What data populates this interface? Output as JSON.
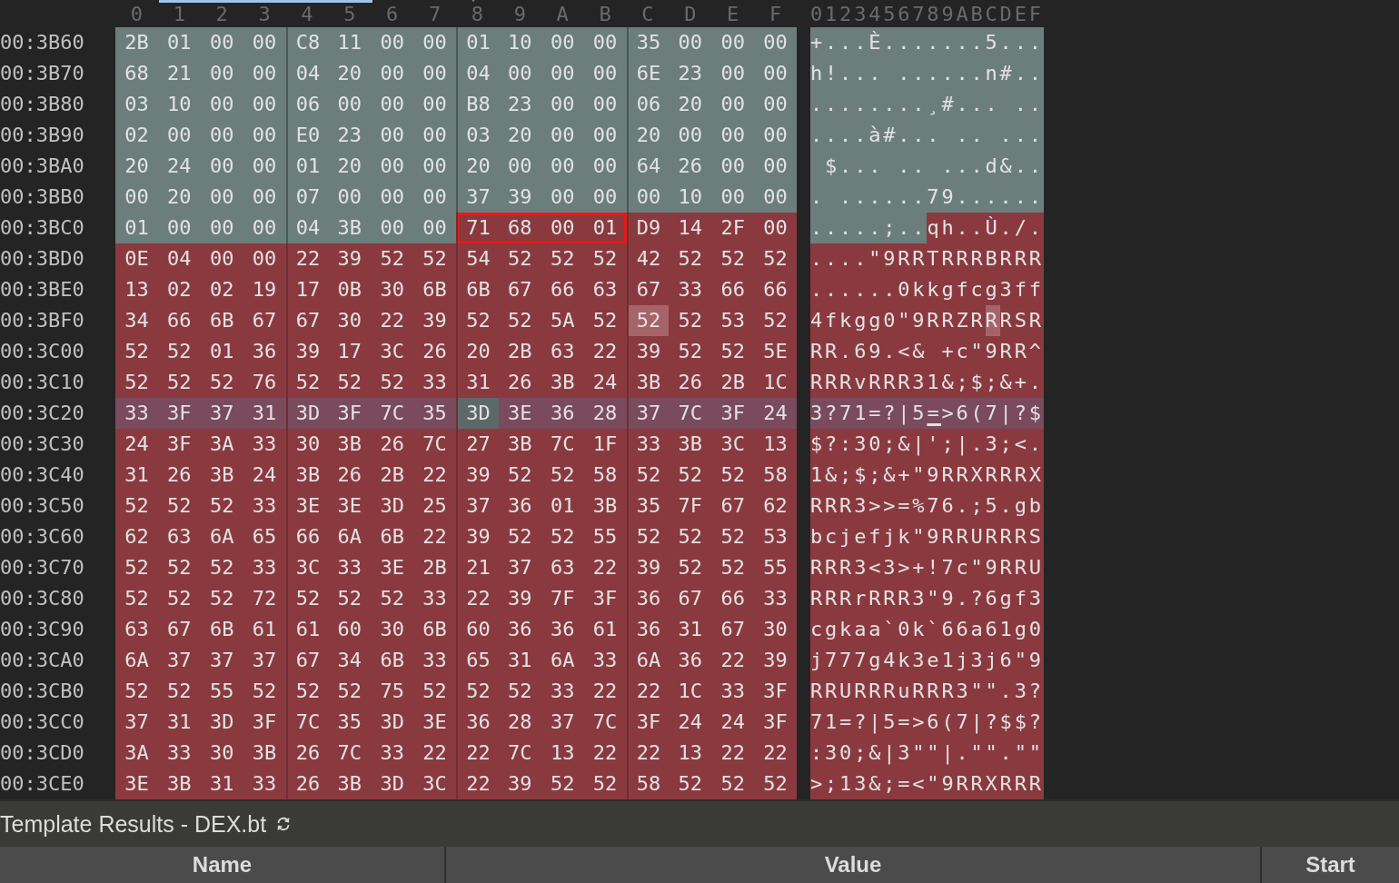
{
  "columns": [
    "0",
    "1",
    "2",
    "3",
    "4",
    "5",
    "6",
    "7",
    "8",
    "9",
    "A",
    "B",
    "C",
    "D",
    "E",
    "F"
  ],
  "ascii_header": "0123456789ABCDEF",
  "rows": [
    {
      "address": "00:3B60",
      "selected": false,
      "segments": [
        {
          "kind": "header",
          "bytes": [
            "2B",
            "01",
            "00",
            "00",
            "C8",
            "11",
            "00",
            "00",
            "01",
            "10",
            "00",
            "00",
            "35",
            "00",
            "00",
            "00"
          ],
          "ascii": "+...È.......5..."
        }
      ]
    },
    {
      "address": "00:3B70",
      "selected": false,
      "segments": [
        {
          "kind": "header",
          "bytes": [
            "68",
            "21",
            "00",
            "00",
            "04",
            "20",
            "00",
            "00",
            "04",
            "00",
            "00",
            "00",
            "6E",
            "23",
            "00",
            "00"
          ],
          "ascii": "h!... ......n#.."
        }
      ]
    },
    {
      "address": "00:3B80",
      "selected": false,
      "segments": [
        {
          "kind": "header",
          "bytes": [
            "03",
            "10",
            "00",
            "00",
            "06",
            "00",
            "00",
            "00",
            "B8",
            "23",
            "00",
            "00",
            "06",
            "20",
            "00",
            "00"
          ],
          "ascii": "........¸#... .."
        }
      ]
    },
    {
      "address": "00:3B90",
      "selected": false,
      "segments": [
        {
          "kind": "header",
          "bytes": [
            "02",
            "00",
            "00",
            "00",
            "E0",
            "23",
            "00",
            "00",
            "03",
            "20",
            "00",
            "00",
            "20",
            "00",
            "00",
            "00"
          ],
          "ascii": "....à#... .. ..."
        }
      ]
    },
    {
      "address": "00:3BA0",
      "selected": false,
      "segments": [
        {
          "kind": "header",
          "bytes": [
            "20",
            "24",
            "00",
            "00",
            "01",
            "20",
            "00",
            "00",
            "20",
            "00",
            "00",
            "00",
            "64",
            "26",
            "00",
            "00"
          ],
          "ascii": " $... .. ...d&.."
        }
      ]
    },
    {
      "address": "00:3BB0",
      "selected": false,
      "segments": [
        {
          "kind": "header",
          "bytes": [
            "00",
            "20",
            "00",
            "00",
            "07",
            "00",
            "00",
            "00",
            "37",
            "39",
            "00",
            "00",
            "00",
            "10",
            "00",
            "00"
          ],
          "ascii": ". ......79......"
        }
      ]
    },
    {
      "address": "00:3BC0",
      "selected": false,
      "segments": [
        {
          "kind": "header",
          "bytes": [
            "01",
            "00",
            "00",
            "00",
            "04",
            "3B",
            "00",
            "00"
          ],
          "ascii": ".....;.."
        },
        {
          "kind": "marked",
          "bytes": [
            "71",
            "68",
            "00",
            "01"
          ],
          "ascii": "qh.."
        },
        {
          "kind": "data",
          "bytes": [
            "D9",
            "14",
            "2F",
            "00"
          ],
          "ascii": "Ù./."
        }
      ]
    },
    {
      "address": "00:3BD0",
      "selected": false,
      "segments": [
        {
          "kind": "data",
          "bytes": [
            "0E",
            "04",
            "00",
            "00",
            "22",
            "39",
            "52",
            "52",
            "54",
            "52",
            "52",
            "52",
            "42",
            "52",
            "52",
            "52"
          ],
          "ascii": "....\"9RRTRRRBRRR"
        }
      ]
    },
    {
      "address": "00:3BE0",
      "selected": false,
      "segments": [
        {
          "kind": "data",
          "bytes": [
            "13",
            "02",
            "02",
            "19",
            "17",
            "0B",
            "30",
            "6B",
            "6B",
            "67",
            "66",
            "63",
            "67",
            "33",
            "66",
            "66"
          ],
          "ascii": "......0kkgfcg3ff"
        }
      ]
    },
    {
      "address": "00:3BF0",
      "selected": false,
      "segments": [
        {
          "kind": "data",
          "bytes": [
            "34",
            "66",
            "6B",
            "67",
            "67",
            "30",
            "22",
            "39",
            "52",
            "52",
            "5A",
            "52"
          ],
          "ascii": "4fkgg0\"9RRZR"
        },
        {
          "kind": "match",
          "bytes": [
            "52"
          ],
          "ascii": "R"
        },
        {
          "kind": "data",
          "bytes": [
            "52",
            "53",
            "52"
          ],
          "ascii": "RSR"
        }
      ]
    },
    {
      "address": "00:3C00",
      "selected": false,
      "segments": [
        {
          "kind": "data",
          "bytes": [
            "52",
            "52",
            "01",
            "36",
            "39",
            "17",
            "3C",
            "26",
            "20",
            "2B",
            "63",
            "22",
            "39",
            "52",
            "52",
            "5E"
          ],
          "ascii": "RR.69.<& +c\"9RR^"
        }
      ]
    },
    {
      "address": "00:3C10",
      "selected": false,
      "segments": [
        {
          "kind": "data",
          "bytes": [
            "52",
            "52",
            "52",
            "76",
            "52",
            "52",
            "52",
            "33",
            "31",
            "26",
            "3B",
            "24",
            "3B",
            "26",
            "2B",
            "1C"
          ],
          "ascii": "RRRvRRR31&;$;&+."
        }
      ]
    },
    {
      "address": "00:3C20",
      "selected": true,
      "segments": [
        {
          "kind": "data",
          "bytes": [
            "33",
            "3F",
            "37",
            "31",
            "3D",
            "3F",
            "7C",
            "35"
          ],
          "ascii": "3?71=?|5"
        },
        {
          "kind": "cursor",
          "bytes": [
            "3D"
          ],
          "ascii": "="
        },
        {
          "kind": "data",
          "bytes": [
            "3E",
            "36",
            "28",
            "37",
            "7C",
            "3F",
            "24"
          ],
          "ascii": ">6(7|?$"
        }
      ]
    },
    {
      "address": "00:3C30",
      "selected": false,
      "segments": [
        {
          "kind": "data",
          "bytes": [
            "24",
            "3F",
            "3A",
            "33",
            "30",
            "3B",
            "26",
            "7C",
            "27",
            "3B",
            "7C",
            "1F",
            "33",
            "3B",
            "3C",
            "13"
          ],
          "ascii": "$?:30;&|';|.3;<."
        }
      ]
    },
    {
      "address": "00:3C40",
      "selected": false,
      "segments": [
        {
          "kind": "data",
          "bytes": [
            "31",
            "26",
            "3B",
            "24",
            "3B",
            "26",
            "2B",
            "22",
            "39",
            "52",
            "52",
            "58",
            "52",
            "52",
            "52",
            "58"
          ],
          "ascii": "1&;$;&+\"9RRXRRRX"
        }
      ]
    },
    {
      "address": "00:3C50",
      "selected": false,
      "segments": [
        {
          "kind": "data",
          "bytes": [
            "52",
            "52",
            "52",
            "33",
            "3E",
            "3E",
            "3D",
            "25",
            "37",
            "36",
            "01",
            "3B",
            "35",
            "7F",
            "67",
            "62"
          ],
          "ascii": "RRR3>>=%76.;5.gb"
        }
      ]
    },
    {
      "address": "00:3C60",
      "selected": false,
      "segments": [
        {
          "kind": "data",
          "bytes": [
            "62",
            "63",
            "6A",
            "65",
            "66",
            "6A",
            "6B",
            "22",
            "39",
            "52",
            "52",
            "55",
            "52",
            "52",
            "52",
            "53"
          ],
          "ascii": "bcjefjk\"9RRURRRS"
        }
      ]
    },
    {
      "address": "00:3C70",
      "selected": false,
      "segments": [
        {
          "kind": "data",
          "bytes": [
            "52",
            "52",
            "52",
            "33",
            "3C",
            "33",
            "3E",
            "2B",
            "21",
            "37",
            "63",
            "22",
            "39",
            "52",
            "52",
            "55"
          ],
          "ascii": "RRR3<3>+!7c\"9RRU"
        }
      ]
    },
    {
      "address": "00:3C80",
      "selected": false,
      "segments": [
        {
          "kind": "data",
          "bytes": [
            "52",
            "52",
            "52",
            "72",
            "52",
            "52",
            "52",
            "33",
            "22",
            "39",
            "7F",
            "3F",
            "36",
            "67",
            "66",
            "33"
          ],
          "ascii": "RRRrRRR3\"9.?6gf3"
        }
      ]
    },
    {
      "address": "00:3C90",
      "selected": false,
      "segments": [
        {
          "kind": "data",
          "bytes": [
            "63",
            "67",
            "6B",
            "61",
            "61",
            "60",
            "30",
            "6B",
            "60",
            "36",
            "36",
            "61",
            "36",
            "31",
            "67",
            "30"
          ],
          "ascii": "cgkaa`0k`66a61g0"
        }
      ]
    },
    {
      "address": "00:3CA0",
      "selected": false,
      "segments": [
        {
          "kind": "data",
          "bytes": [
            "6A",
            "37",
            "37",
            "37",
            "67",
            "34",
            "6B",
            "33",
            "65",
            "31",
            "6A",
            "33",
            "6A",
            "36",
            "22",
            "39"
          ],
          "ascii": "j777g4k3e1j3j6\"9"
        }
      ]
    },
    {
      "address": "00:3CB0",
      "selected": false,
      "segments": [
        {
          "kind": "data",
          "bytes": [
            "52",
            "52",
            "55",
            "52",
            "52",
            "52",
            "75",
            "52",
            "52",
            "52",
            "33",
            "22",
            "22",
            "1C",
            "33",
            "3F"
          ],
          "ascii": "RRURRRuRRR3\"\".3?"
        }
      ]
    },
    {
      "address": "00:3CC0",
      "selected": false,
      "segments": [
        {
          "kind": "data",
          "bytes": [
            "37",
            "31",
            "3D",
            "3F",
            "7C",
            "35",
            "3D",
            "3E",
            "36",
            "28",
            "37",
            "7C",
            "3F",
            "24",
            "24",
            "3F"
          ],
          "ascii": "71=?|5=>6(7|?$$?"
        }
      ]
    },
    {
      "address": "00:3CD0",
      "selected": false,
      "segments": [
        {
          "kind": "data",
          "bytes": [
            "3A",
            "33",
            "30",
            "3B",
            "26",
            "7C",
            "33",
            "22",
            "22",
            "7C",
            "13",
            "22",
            "22",
            "13",
            "22",
            "22"
          ],
          "ascii": ":30;&|3\"\"|.\"\".\"\""
        }
      ]
    },
    {
      "address": "00:3CE0",
      "selected": false,
      "segments": [
        {
          "kind": "data",
          "bytes": [
            "3E",
            "3B",
            "31",
            "33",
            "26",
            "3B",
            "3D",
            "3C",
            "22",
            "39",
            "52",
            "52",
            "58",
            "52",
            "52",
            "52"
          ],
          "ascii": ">;13&;=<\"9RRXRRR"
        }
      ]
    }
  ],
  "panel": {
    "title": "Template Results - DEX.bt",
    "columns": [
      "Name",
      "Value",
      "Start"
    ]
  }
}
